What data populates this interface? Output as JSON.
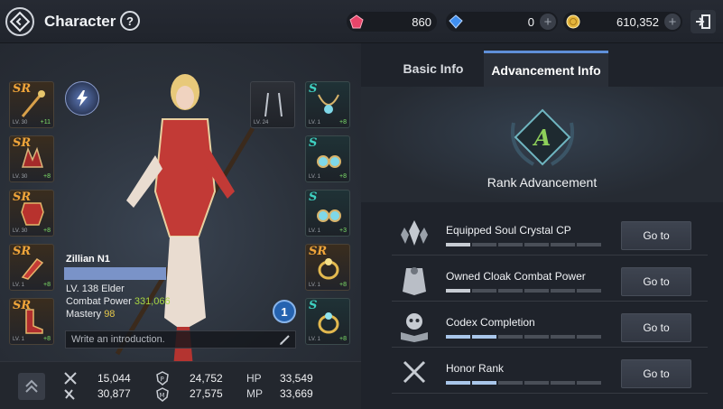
{
  "header": {
    "title": "Character",
    "help_label": "?",
    "currencies": [
      {
        "name": "red-gem",
        "value": "860",
        "color": "#e8456a"
      },
      {
        "name": "blue-gem",
        "value": "0",
        "color": "#3f8ff0"
      },
      {
        "name": "gold-coin",
        "value": "610,352",
        "color": "#e3b43b"
      }
    ],
    "plus_label": "+"
  },
  "equipment_left": [
    {
      "grade": "SR",
      "lv": "LV. 30",
      "enhance": "+11",
      "icon": "staff-icon"
    },
    {
      "grade": "SR",
      "lv": "LV. 30",
      "enhance": "+8",
      "icon": "helmet-icon"
    },
    {
      "grade": "SR",
      "lv": "LV. 30",
      "enhance": "+8",
      "icon": "armor-icon"
    },
    {
      "grade": "SR",
      "lv": "LV. 1",
      "enhance": "+8",
      "icon": "gloves-icon"
    },
    {
      "grade": "SR",
      "lv": "LV. 1",
      "enhance": "+8",
      "icon": "boots-icon"
    }
  ],
  "equipment_right": [
    {
      "grade": "",
      "lv": "LV. 24",
      "enhance": "",
      "icon": "earring-dangle-icon"
    },
    {
      "grade": "S",
      "lv": "LV. 1",
      "enhance": "+8",
      "icon": "necklace-icon"
    },
    {
      "grade": "S",
      "lv": "LV. 1",
      "enhance": "+8",
      "icon": "earring-icon"
    },
    {
      "grade": "S",
      "lv": "LV. 1",
      "enhance": "+3",
      "icon": "earring-icon"
    },
    {
      "grade": "SR",
      "lv": "LV. 1",
      "enhance": "+8",
      "icon": "ring-icon"
    },
    {
      "grade": "S",
      "lv": "LV. 1",
      "enhance": "+8",
      "icon": "ring-icon"
    }
  ],
  "character": {
    "name": "Zillian N1",
    "level_line": "LV. 138  Elder",
    "combat_power_label": "Combat Power",
    "combat_power_value": "331,066",
    "mastery_label": "Mastery",
    "mastery_value": "98",
    "intro_placeholder": "Write an introduction.",
    "badge": "1"
  },
  "stats": {
    "attack": "15,044",
    "defense": "30,877",
    "p_value": "24,752",
    "m_value": "27,575",
    "hp_label": "HP",
    "hp_value": "33,549",
    "mp_label": "MP",
    "mp_value": "33,669"
  },
  "tabs": {
    "basic": "Basic Info",
    "advancement": "Advancement Info"
  },
  "rank": {
    "letter": "A",
    "label": "Rank Advancement"
  },
  "advancement_items": [
    {
      "title": "Equipped Soul Crystal CP",
      "progress": 1,
      "segments": 6,
      "button": "Go to",
      "icon": "crystal-icon"
    },
    {
      "title": "Owned Cloak Combat Power",
      "progress": 1,
      "segments": 6,
      "button": "Go to",
      "icon": "cloak-icon"
    },
    {
      "title": "Codex Completion",
      "progress": 2,
      "segments": 6,
      "button": "Go to",
      "icon": "skull-book-icon"
    },
    {
      "title": "Honor Rank",
      "progress": 2,
      "segments": 6,
      "button": "Go to",
      "icon": "crossed-swords-icon"
    }
  ]
}
